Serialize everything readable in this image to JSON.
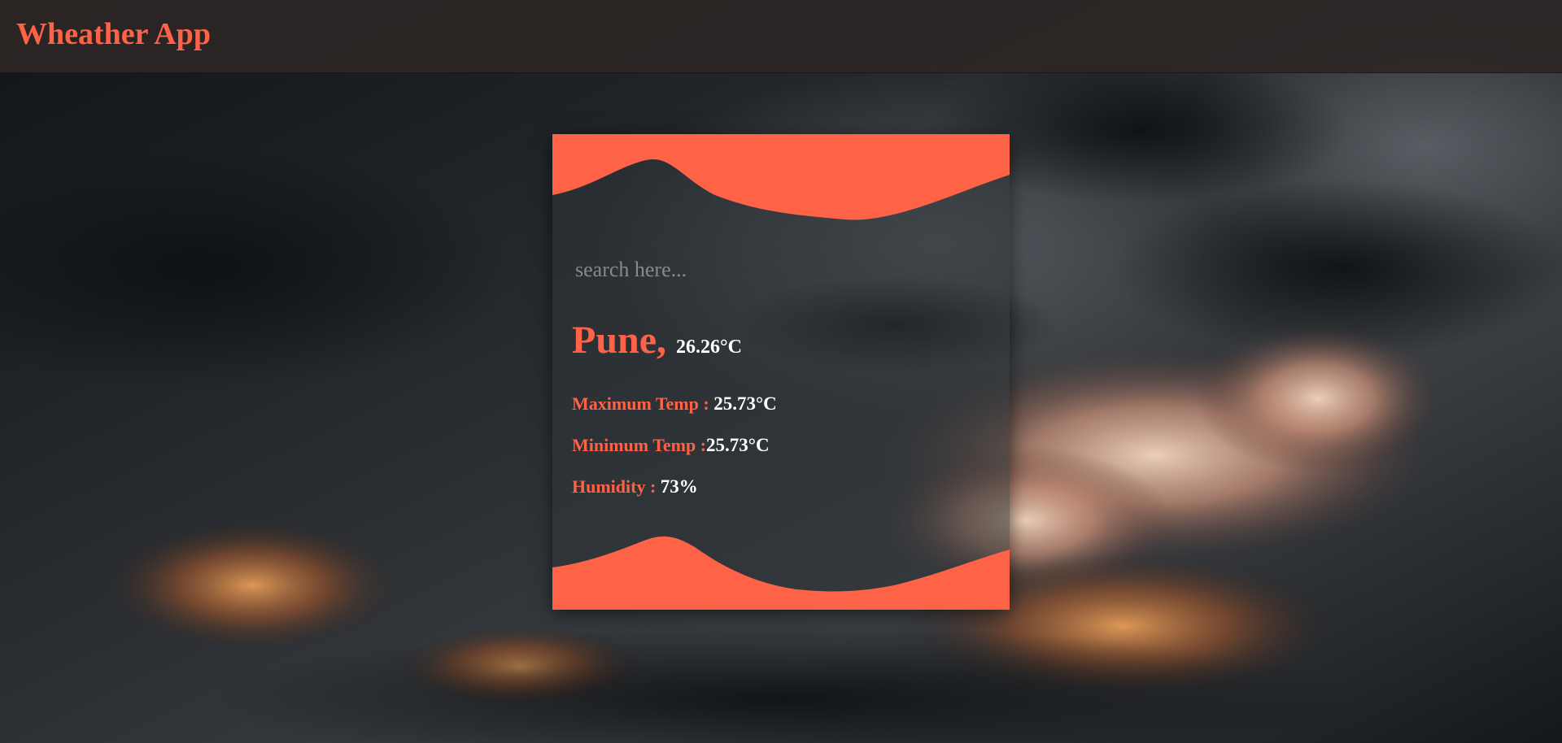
{
  "navbar": {
    "brand": "Wheather App"
  },
  "search": {
    "placeholder": "search here..."
  },
  "weather": {
    "city": "Pune,",
    "current_temp": "26.26°C",
    "max_label": "Maximum Temp : ",
    "max_value": "25.73°C",
    "min_label": "Minimum Temp :",
    "min_value": "25.73°C",
    "humidity_label": "Humidity : ",
    "humidity_value": "73%"
  },
  "colors": {
    "accent": "#ff6347",
    "text": "#ffffff",
    "navbar": "#2c2625"
  }
}
